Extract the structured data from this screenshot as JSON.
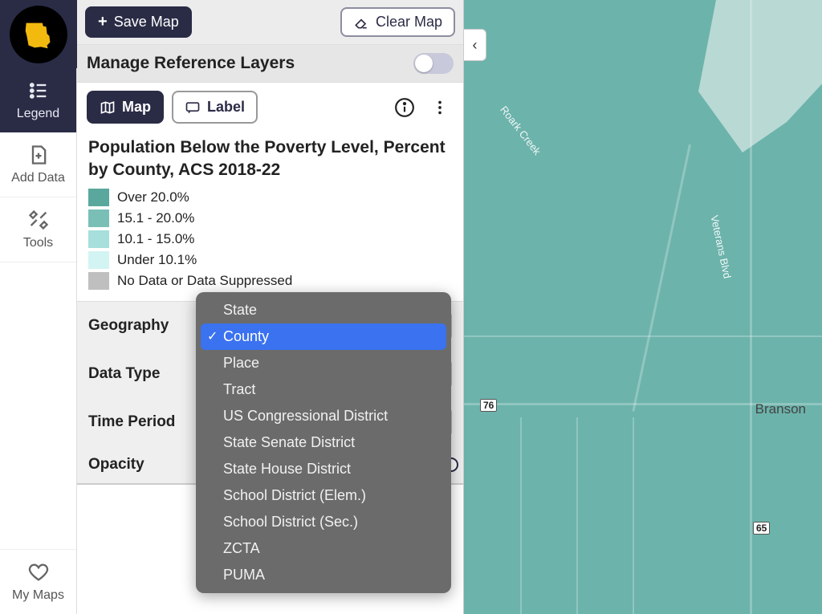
{
  "nav": {
    "legend": "Legend",
    "add_data": "Add Data",
    "tools": "Tools",
    "my_maps": "My Maps"
  },
  "toolbar": {
    "save_label": "Save Map",
    "clear_label": "Clear Map"
  },
  "reference_layers": {
    "title": "Manage Reference Layers",
    "enabled": false
  },
  "tabs": {
    "map": "Map",
    "label": "Label"
  },
  "legend": {
    "title": "Population Below the Poverty Level, Percent by County, ACS 2018-22",
    "items": [
      {
        "label": "Over 20.0%",
        "color": "#5aa79d"
      },
      {
        "label": "15.1 - 20.0%",
        "color": "#7abfb6"
      },
      {
        "label": "10.1 - 15.0%",
        "color": "#a6dfdb"
      },
      {
        "label": "Under 10.1%",
        "color": "#d2f4f3"
      },
      {
        "label": "No Data or Data Suppressed",
        "color": "#bfbfbf"
      }
    ]
  },
  "controls": {
    "geography": {
      "label": "Geography",
      "selected": "County"
    },
    "datatype": {
      "label": "Data Type"
    },
    "timeperiod": {
      "label": "Time Period"
    },
    "opacity": {
      "label": "Opacity",
      "value": 100
    }
  },
  "geography_options": [
    "State",
    "County",
    "Place",
    "Tract",
    "US Congressional District",
    "State Senate District",
    "State House District",
    "School District (Elem.)",
    "School District (Sec.)",
    "ZCTA",
    "PUMA"
  ],
  "map": {
    "city": "Branson",
    "road_labels": {
      "roark": "Roark Creek",
      "veterans": "Veterans Blvd"
    },
    "routes": {
      "r76": "76",
      "r65": "65"
    },
    "collapse_glyph": "‹"
  }
}
